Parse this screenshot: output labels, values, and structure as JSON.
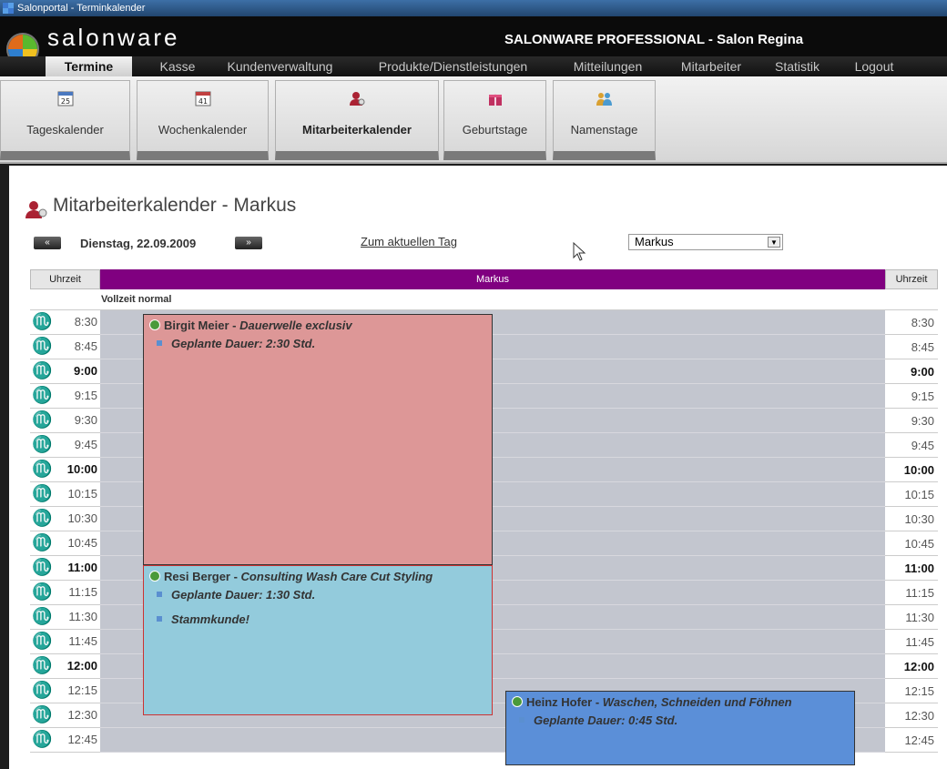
{
  "window": {
    "title": "Salonportal - Terminkalender"
  },
  "app": {
    "brand": "salonware",
    "header_title": "SALONWARE PROFESSIONAL - Salon Regina"
  },
  "nav": [
    "Termine",
    "Kasse",
    "Kundenverwaltung",
    "Produkte/Dienstleistungen",
    "Mitteilungen",
    "Mitarbeiter",
    "Statistik",
    "Logout"
  ],
  "subnav": [
    {
      "label": "Tageskalender",
      "icon": "calendar-day-icon",
      "badge": "25"
    },
    {
      "label": "Wochenkalender",
      "icon": "calendar-week-icon",
      "badge": "41"
    },
    {
      "label": "Mitarbeiterkalender",
      "icon": "employee-icon",
      "active": true
    },
    {
      "label": "Geburtstage",
      "icon": "gift-icon"
    },
    {
      "label": "Namenstage",
      "icon": "people-icon"
    }
  ],
  "page": {
    "title": "Mitarbeiterkalender - Markus",
    "prev": "«",
    "next": "»",
    "date": "Dienstag, 22.09.2009",
    "today_link": "Zum aktuellen Tag",
    "employee_select": "Markus"
  },
  "table": {
    "left_header": "Uhrzeit",
    "right_header": "Uhrzeit",
    "column_header": "Markus",
    "shift": "Vollzeit normal",
    "times": [
      "8:30",
      "8:45",
      "9:00",
      "9:15",
      "9:30",
      "9:45",
      "10:00",
      "10:15",
      "10:30",
      "10:45",
      "11:00",
      "11:15",
      "11:30",
      "11:45",
      "12:00",
      "12:15",
      "12:30",
      "12:45"
    ],
    "time_symbol": "♏"
  },
  "appointments": [
    {
      "name": "Birgit Meier",
      "service": "Dauerwelle exclusiv",
      "notes": [
        "Geplante Dauer: 2:30 Std."
      ],
      "color": "#dd9797"
    },
    {
      "name": "Resi Berger",
      "service": "Consulting Wash Care Cut Styling",
      "notes": [
        "Geplante Dauer: 1:30 Std.",
        "Stammkunde!"
      ],
      "color": "#93cbdc"
    },
    {
      "name": "Heinz Hofer",
      "service": "Waschen, Schneiden und Föhnen",
      "notes": [
        "Geplante Dauer: 0:45 Std."
      ],
      "color": "#5b8fd8"
    }
  ],
  "colors": {
    "column_header": "#800080",
    "grid": "#c3c6cf"
  }
}
